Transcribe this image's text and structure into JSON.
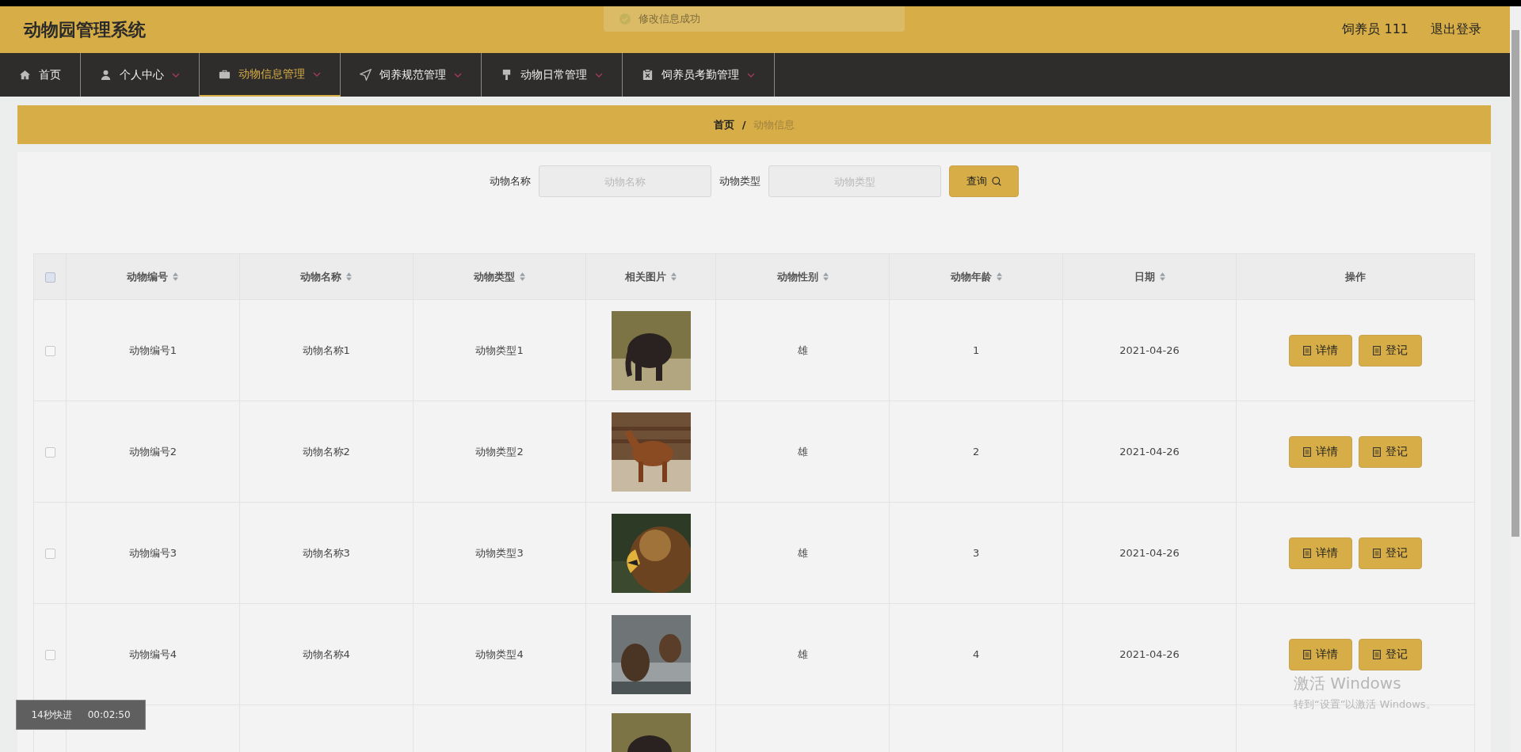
{
  "header": {
    "title": "动物园管理系统",
    "user": "饲养员 111",
    "logout": "退出登录"
  },
  "toast": {
    "text": "修改信息成功"
  },
  "nav": [
    {
      "label": "首页",
      "has_menu": false,
      "selected": false
    },
    {
      "label": "个人中心",
      "has_menu": true,
      "selected": false
    },
    {
      "label": "动物信息管理",
      "has_menu": true,
      "selected": true
    },
    {
      "label": "饲养规范管理",
      "has_menu": true,
      "selected": false
    },
    {
      "label": "动物日常管理",
      "has_menu": true,
      "selected": false
    },
    {
      "label": "饲养员考勤管理",
      "has_menu": true,
      "selected": false
    }
  ],
  "breadcrumb": {
    "items": [
      {
        "label": "首页",
        "selected": false
      },
      {
        "label": "动物信息",
        "selected": true
      }
    ],
    "separator": "/"
  },
  "search": {
    "fields": [
      {
        "label": "动物名称",
        "placeholder": "动物名称"
      },
      {
        "label": "动物类型",
        "placeholder": "动物类型"
      }
    ],
    "button": "查询"
  },
  "table": {
    "select_all": false,
    "columns": [
      {
        "label": "动物编号",
        "sortable": true
      },
      {
        "label": "动物名称",
        "sortable": true
      },
      {
        "label": "动物类型",
        "sortable": true
      },
      {
        "label": "相关图片",
        "sortable": true
      },
      {
        "label": "动物性别",
        "sortable": true
      },
      {
        "label": "动物年龄",
        "sortable": true
      },
      {
        "label": "日期",
        "sortable": true
      },
      {
        "label": "操作",
        "sortable": false
      }
    ],
    "rows": [
      {
        "checked": false,
        "number": "动物编号1",
        "name": "动物名称1",
        "type": "动物类型1",
        "sex": "雄",
        "age": "1",
        "date": "2021-04-26",
        "actions": [
          "详情",
          "登记"
        ]
      },
      {
        "checked": false,
        "number": "动物编号2",
        "name": "动物名称2",
        "type": "动物类型2",
        "sex": "雄",
        "age": "2",
        "date": "2021-04-26",
        "actions": [
          "详情",
          "登记"
        ]
      },
      {
        "checked": false,
        "number": "动物编号3",
        "name": "动物名称3",
        "type": "动物类型3",
        "sex": "雄",
        "age": "3",
        "date": "2021-04-26",
        "actions": [
          "详情",
          "登记"
        ]
      },
      {
        "checked": false,
        "number": "动物编号4",
        "name": "动物名称4",
        "type": "动物类型4",
        "sex": "雄",
        "age": "4",
        "date": "2021-04-26",
        "actions": [
          "详情",
          "登记"
        ]
      }
    ]
  },
  "video_overlay": {
    "label": "14秒快进",
    "time": "00:02:50"
  },
  "activation": {
    "title": "激活 Windows",
    "hint": "转到“设置”以激活 Windows。"
  }
}
